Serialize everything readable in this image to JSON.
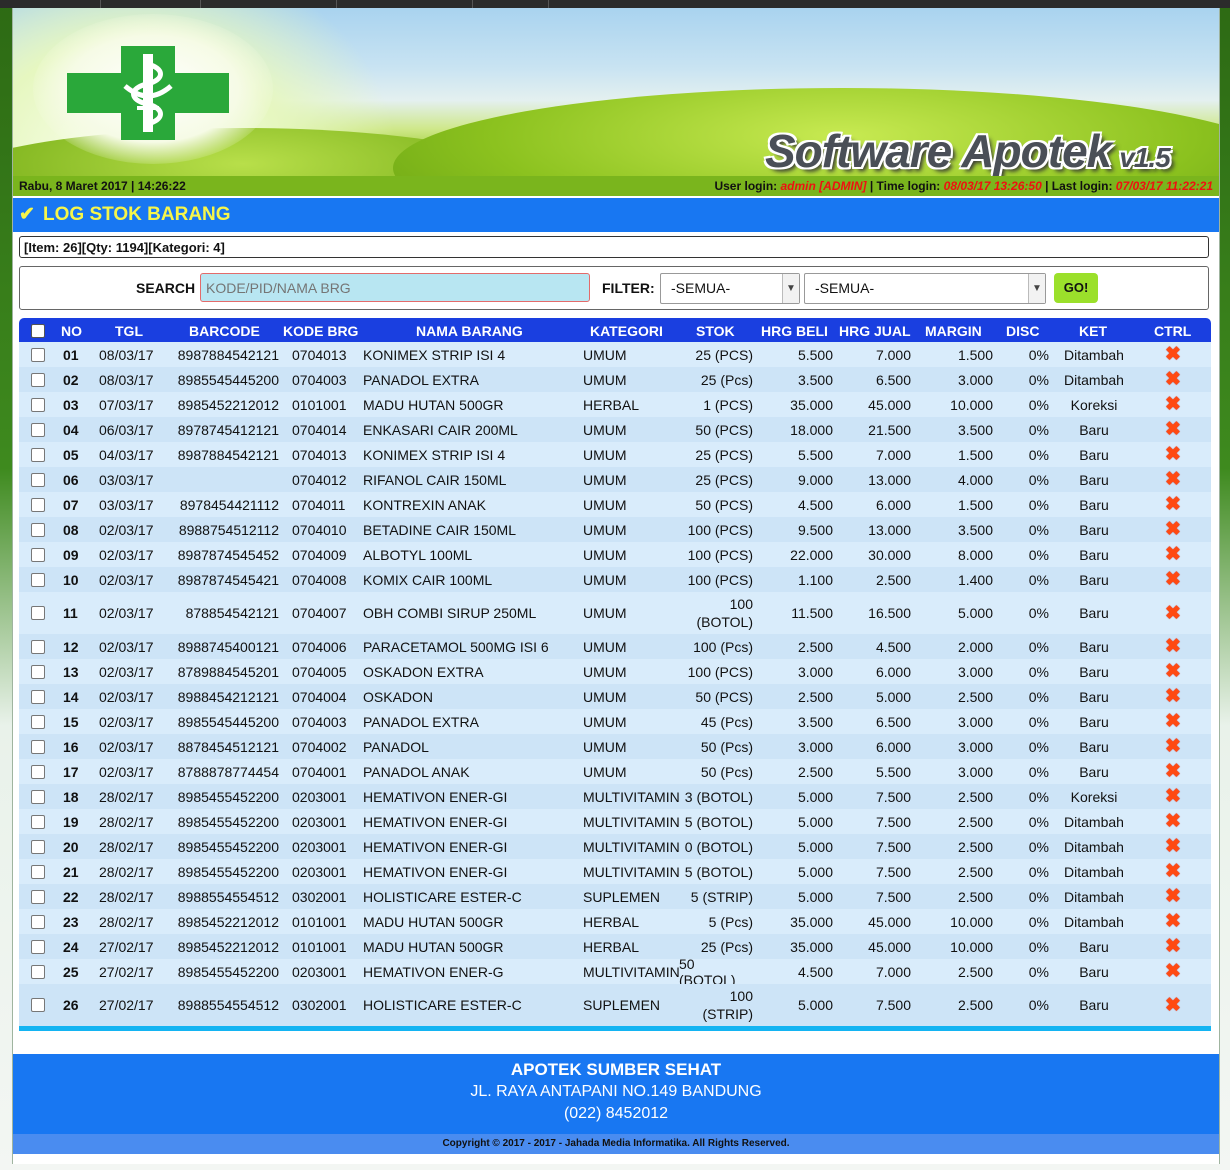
{
  "header": {
    "brand_name": "Software Apotek",
    "version": "v1.5"
  },
  "infobar": {
    "datetime": "Rabu, 8 Maret 2017 | 14:26:22",
    "user_login_label": "User login:",
    "user_login_value": "admin [ADMIN]",
    "time_login_label": "| Time login:",
    "time_login_value": "08/03/17 13:26:50",
    "last_login_label": "| Last login:",
    "last_login_value": "07/03/17 11:22:21"
  },
  "section": {
    "title": "LOG STOK BARANG",
    "summary": "[Item: 26][Qty: 1194][Kategori: 4]"
  },
  "filters": {
    "search_label": "SEARCH",
    "search_placeholder": "KODE/PID/NAMA BRG",
    "filter_label": "FILTER:",
    "filter1_value": "-SEMUA-",
    "filter2_value": "-SEMUA-",
    "go_label": "GO!"
  },
  "table": {
    "headers": [
      "NO",
      "TGL",
      "BARCODE",
      "KODE BRG",
      "NAMA BARANG",
      "KATEGORI",
      "STOK",
      "HRG BELI",
      "HRG JUAL",
      "MARGIN",
      "DISC",
      "KET",
      "CTRL"
    ],
    "rows": [
      {
        "no": "01",
        "tgl": "08/03/17",
        "barcode": "8987884542121",
        "kode": "0704013",
        "nama": "KONIMEX STRIP ISI 4",
        "kategori": "UMUM",
        "stok": "25 (PCS)",
        "beli": "5.500",
        "jual": "7.000",
        "margin": "1.500",
        "disc": "0%",
        "ket": "Ditambah"
      },
      {
        "no": "02",
        "tgl": "08/03/17",
        "barcode": "8985545445200",
        "kode": "0704003",
        "nama": "PANADOL EXTRA",
        "kategori": "UMUM",
        "stok": "25 (Pcs)",
        "beli": "3.500",
        "jual": "6.500",
        "margin": "3.000",
        "disc": "0%",
        "ket": "Ditambah"
      },
      {
        "no": "03",
        "tgl": "07/03/17",
        "barcode": "8985452212012",
        "kode": "0101001",
        "nama": "MADU HUTAN 500GR",
        "kategori": "HERBAL",
        "stok": "1 (PCS)",
        "beli": "35.000",
        "jual": "45.000",
        "margin": "10.000",
        "disc": "0%",
        "ket": "Koreksi"
      },
      {
        "no": "04",
        "tgl": "06/03/17",
        "barcode": "8978745412121",
        "kode": "0704014",
        "nama": "ENKASARI CAIR 200ML",
        "kategori": "UMUM",
        "stok": "50 (PCS)",
        "beli": "18.000",
        "jual": "21.500",
        "margin": "3.500",
        "disc": "0%",
        "ket": "Baru"
      },
      {
        "no": "05",
        "tgl": "04/03/17",
        "barcode": "8987884542121",
        "kode": "0704013",
        "nama": "KONIMEX STRIP ISI 4",
        "kategori": "UMUM",
        "stok": "25 (PCS)",
        "beli": "5.500",
        "jual": "7.000",
        "margin": "1.500",
        "disc": "0%",
        "ket": "Baru"
      },
      {
        "no": "06",
        "tgl": "03/03/17",
        "barcode": "",
        "kode": "0704012",
        "nama": "RIFANOL CAIR 150ML",
        "kategori": "UMUM",
        "stok": "25 (PCS)",
        "beli": "9.000",
        "jual": "13.000",
        "margin": "4.000",
        "disc": "0%",
        "ket": "Baru"
      },
      {
        "no": "07",
        "tgl": "03/03/17",
        "barcode": "8978454421112",
        "kode": "0704011",
        "nama": "KONTREXIN ANAK",
        "kategori": "UMUM",
        "stok": "50 (PCS)",
        "beli": "4.500",
        "jual": "6.000",
        "margin": "1.500",
        "disc": "0%",
        "ket": "Baru"
      },
      {
        "no": "08",
        "tgl": "02/03/17",
        "barcode": "8988754512112",
        "kode": "0704010",
        "nama": "BETADINE CAIR 150ML",
        "kategori": "UMUM",
        "stok": "100 (PCS)",
        "beli": "9.500",
        "jual": "13.000",
        "margin": "3.500",
        "disc": "0%",
        "ket": "Baru"
      },
      {
        "no": "09",
        "tgl": "02/03/17",
        "barcode": "8987874545452",
        "kode": "0704009",
        "nama": "ALBOTYL 100ML",
        "kategori": "UMUM",
        "stok": "100 (PCS)",
        "beli": "22.000",
        "jual": "30.000",
        "margin": "8.000",
        "disc": "0%",
        "ket": "Baru"
      },
      {
        "no": "10",
        "tgl": "02/03/17",
        "barcode": "8987874545421",
        "kode": "0704008",
        "nama": "KOMIX CAIR 100ML",
        "kategori": "UMUM",
        "stok": "100 (PCS)",
        "beli": "1.100",
        "jual": "2.500",
        "margin": "1.400",
        "disc": "0%",
        "ket": "Baru"
      },
      {
        "no": "11",
        "tgl": "02/03/17",
        "barcode": "878854542121",
        "kode": "0704007",
        "nama": "OBH COMBI SIRUP 250ML",
        "kategori": "UMUM",
        "stok": "100",
        "stok2": "(BOTOL)",
        "beli": "11.500",
        "jual": "16.500",
        "margin": "5.000",
        "disc": "0%",
        "ket": "Baru"
      },
      {
        "no": "12",
        "tgl": "02/03/17",
        "barcode": "8988745400121",
        "kode": "0704006",
        "nama": "PARACETAMOL 500MG ISI 6",
        "kategori": "UMUM",
        "stok": "100 (Pcs)",
        "beli": "2.500",
        "jual": "4.500",
        "margin": "2.000",
        "disc": "0%",
        "ket": "Baru"
      },
      {
        "no": "13",
        "tgl": "02/03/17",
        "barcode": "8789884545201",
        "kode": "0704005",
        "nama": "OSKADON EXTRA",
        "kategori": "UMUM",
        "stok": "100 (PCS)",
        "beli": "3.000",
        "jual": "6.000",
        "margin": "3.000",
        "disc": "0%",
        "ket": "Baru"
      },
      {
        "no": "14",
        "tgl": "02/03/17",
        "barcode": "8988454212121",
        "kode": "0704004",
        "nama": "OSKADON",
        "kategori": "UMUM",
        "stok": "50 (PCS)",
        "beli": "2.500",
        "jual": "5.000",
        "margin": "2.500",
        "disc": "0%",
        "ket": "Baru"
      },
      {
        "no": "15",
        "tgl": "02/03/17",
        "barcode": "8985545445200",
        "kode": "0704003",
        "nama": "PANADOL EXTRA",
        "kategori": "UMUM",
        "stok": "45 (Pcs)",
        "beli": "3.500",
        "jual": "6.500",
        "margin": "3.000",
        "disc": "0%",
        "ket": "Baru"
      },
      {
        "no": "16",
        "tgl": "02/03/17",
        "barcode": "8878454512121",
        "kode": "0704002",
        "nama": "PANADOL",
        "kategori": "UMUM",
        "stok": "50 (Pcs)",
        "beli": "3.000",
        "jual": "6.000",
        "margin": "3.000",
        "disc": "0%",
        "ket": "Baru"
      },
      {
        "no": "17",
        "tgl": "02/03/17",
        "barcode": "8788878774454",
        "kode": "0704001",
        "nama": "PANADOL ANAK",
        "kategori": "UMUM",
        "stok": "50 (Pcs)",
        "beli": "2.500",
        "jual": "5.500",
        "margin": "3.000",
        "disc": "0%",
        "ket": "Baru"
      },
      {
        "no": "18",
        "tgl": "28/02/17",
        "barcode": "8985455452200",
        "kode": "0203001",
        "nama": "HEMATIVON ENER-GI",
        "kategori": "MULTIVITAMIN",
        "stok": "3 (BOTOL)",
        "beli": "5.000",
        "jual": "7.500",
        "margin": "2.500",
        "disc": "0%",
        "ket": "Koreksi"
      },
      {
        "no": "19",
        "tgl": "28/02/17",
        "barcode": "8985455452200",
        "kode": "0203001",
        "nama": "HEMATIVON ENER-GI",
        "kategori": "MULTIVITAMIN",
        "stok": "5 (BOTOL)",
        "beli": "5.000",
        "jual": "7.500",
        "margin": "2.500",
        "disc": "0%",
        "ket": "Ditambah"
      },
      {
        "no": "20",
        "tgl": "28/02/17",
        "barcode": "8985455452200",
        "kode": "0203001",
        "nama": "HEMATIVON ENER-GI",
        "kategori": "MULTIVITAMIN",
        "stok": "0 (BOTOL)",
        "beli": "5.000",
        "jual": "7.500",
        "margin": "2.500",
        "disc": "0%",
        "ket": "Ditambah"
      },
      {
        "no": "21",
        "tgl": "28/02/17",
        "barcode": "8985455452200",
        "kode": "0203001",
        "nama": "HEMATIVON ENER-GI",
        "kategori": "MULTIVITAMIN",
        "stok": "5 (BOTOL)",
        "beli": "5.000",
        "jual": "7.500",
        "margin": "2.500",
        "disc": "0%",
        "ket": "Ditambah"
      },
      {
        "no": "22",
        "tgl": "28/02/17",
        "barcode": "8988554554512",
        "kode": "0302001",
        "nama": "HOLISTICARE ESTER-C",
        "kategori": "SUPLEMEN",
        "stok": "5 (STRIP)",
        "beli": "5.000",
        "jual": "7.500",
        "margin": "2.500",
        "disc": "0%",
        "ket": "Ditambah"
      },
      {
        "no": "23",
        "tgl": "28/02/17",
        "barcode": "8985452212012",
        "kode": "0101001",
        "nama": "MADU HUTAN 500GR",
        "kategori": "HERBAL",
        "stok": "5 (Pcs)",
        "beli": "35.000",
        "jual": "45.000",
        "margin": "10.000",
        "disc": "0%",
        "ket": "Ditambah"
      },
      {
        "no": "24",
        "tgl": "27/02/17",
        "barcode": "8985452212012",
        "kode": "0101001",
        "nama": "MADU HUTAN 500GR",
        "kategori": "HERBAL",
        "stok": "25 (Pcs)",
        "beli": "35.000",
        "jual": "45.000",
        "margin": "10.000",
        "disc": "0%",
        "ket": "Baru"
      },
      {
        "no": "25",
        "tgl": "27/02/17",
        "barcode": "8985455452200",
        "kode": "0203001",
        "nama": "HEMATIVON ENER-G",
        "kategori": "MULTIVITAMIN",
        "stok": "50 (BOTOL)",
        "beli": "4.500",
        "jual": "7.000",
        "margin": "2.500",
        "disc": "0%",
        "ket": "Baru"
      },
      {
        "no": "26",
        "tgl": "27/02/17",
        "barcode": "8988554554512",
        "kode": "0302001",
        "nama": "HOLISTICARE ESTER-C",
        "kategori": "SUPLEMEN",
        "stok": "100",
        "stok2": "(STRIP)",
        "beli": "5.000",
        "jual": "7.500",
        "margin": "2.500",
        "disc": "0%",
        "ket": "Baru"
      }
    ]
  },
  "footer": {
    "name": "APOTEK SUMBER SEHAT",
    "address": "JL. RAYA ANTAPANI NO.149 BANDUNG",
    "phone": "(022) 8452012",
    "copyright": "Copyright © 2017 - 2017 - Jahada Media Informatika. All Rights Reserved."
  },
  "colors": {
    "accent_blue": "#1877f2",
    "header_blue": "#1a3fe0",
    "title_yellow": "#f6f64a",
    "cross_green": "#2aa83a",
    "go_green": "#9be02b",
    "delete_red": "#ff4a12"
  },
  "icons": {
    "check": "check-icon",
    "delete": "delete-x-icon",
    "dropdown": "chevron-down-icon"
  }
}
